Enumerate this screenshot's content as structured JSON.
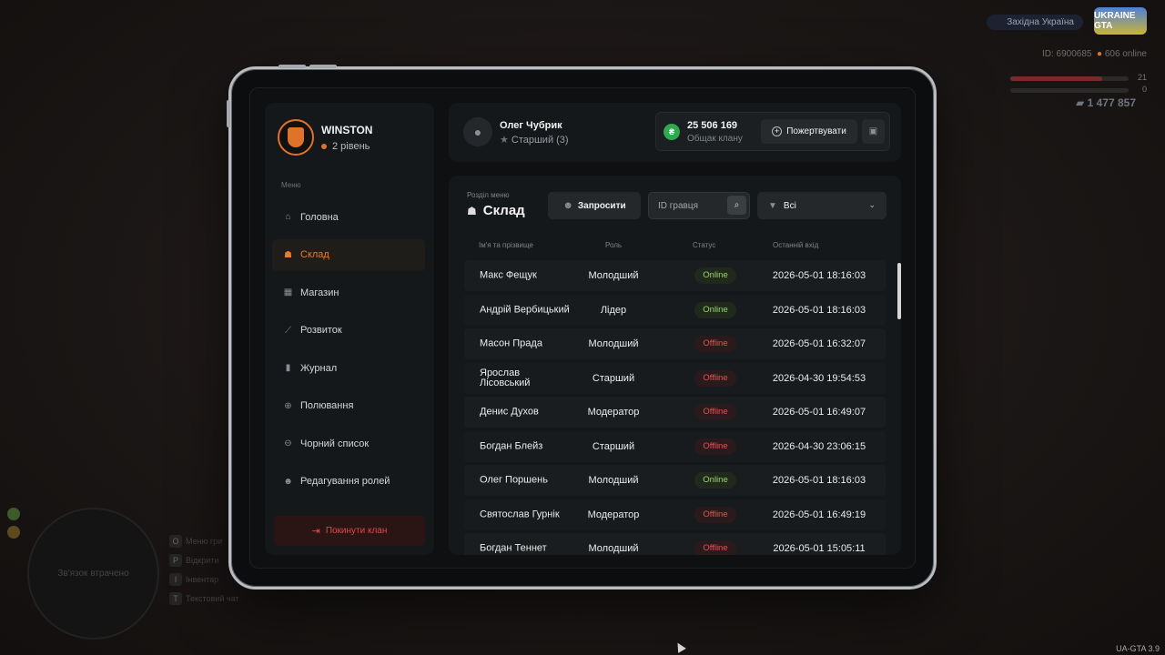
{
  "hud": {
    "region": "Західна Україна",
    "logo": "UKRAINE GTA",
    "id_line": "ID: 6900685",
    "online": "606 online",
    "bar1_value": "21",
    "bar2_value": "0",
    "money": "1 477 857",
    "version": "UA-GTA 3.9",
    "minimap_text": "Зв'язок втрачено",
    "keys": [
      {
        "key": "O",
        "label": "Меню гри"
      },
      {
        "key": "P",
        "label": "Відкрити"
      },
      {
        "key": "I",
        "label": "Інвентар"
      },
      {
        "key": "T",
        "label": "Текстовий чат"
      }
    ]
  },
  "clan": {
    "name": "WINSTON",
    "level": "2 рівень"
  },
  "menu": {
    "caption": "Меню",
    "items": [
      {
        "label": "Головна",
        "icon": "home-icon",
        "glyph": "⌂"
      },
      {
        "label": "Склад",
        "icon": "people-icon",
        "glyph": "☗"
      },
      {
        "label": "Магазин",
        "icon": "shop-icon",
        "glyph": "▦"
      },
      {
        "label": "Розвиток",
        "icon": "chart-icon",
        "glyph": "⟋"
      },
      {
        "label": "Журнал",
        "icon": "book-icon",
        "glyph": "▮"
      },
      {
        "label": "Полювання",
        "icon": "target-icon",
        "glyph": "⊕"
      },
      {
        "label": "Чорний список",
        "icon": "block-icon",
        "glyph": "⊖"
      },
      {
        "label": "Редагування ролей",
        "icon": "user-edit-icon",
        "glyph": "☻"
      }
    ],
    "active_index": 1,
    "leave_label": "Покинути клан"
  },
  "profile": {
    "name": "Олег Чубрик",
    "rank": "Старший (3)"
  },
  "balance": {
    "value": "25 506 169",
    "label": "Общак клану",
    "donate_label": "Пожертвувати"
  },
  "section": {
    "caption": "Розділ меню",
    "title": "Склад",
    "invite_label": "Запросити",
    "search_placeholder": "ID гравця",
    "filter_value": "Всі"
  },
  "table": {
    "headers": {
      "name": "Ім'я та прізвище",
      "role": "Роль",
      "status": "Статус",
      "last": "Останній вхід"
    },
    "rows": [
      {
        "name": "Макс Фещук",
        "role": "Молодший",
        "status": "Online",
        "last": "2026-05-01 18:16:03"
      },
      {
        "name": "Андрій Вербицький",
        "role": "Лідер",
        "status": "Online",
        "last": "2026-05-01 18:16:03"
      },
      {
        "name": "Масон Прада",
        "role": "Молодший",
        "status": "Offline",
        "last": "2026-05-01 16:32:07"
      },
      {
        "name": "Ярослав Лісовський",
        "role": "Старший",
        "status": "Offline",
        "last": "2026-04-30 19:54:53"
      },
      {
        "name": "Денис Духов",
        "role": "Модератор",
        "status": "Offline",
        "last": "2026-05-01 16:49:07"
      },
      {
        "name": "Богдан Блейз",
        "role": "Старший",
        "status": "Offline",
        "last": "2026-04-30 23:06:15"
      },
      {
        "name": "Олег Поршень",
        "role": "Молодший",
        "status": "Online",
        "last": "2026-05-01 18:16:03"
      },
      {
        "name": "Святослав Гурнік",
        "role": "Модератор",
        "status": "Offline",
        "last": "2026-05-01 16:49:19"
      },
      {
        "name": "Богдан Теннет",
        "role": "Молодший",
        "status": "Offline",
        "last": "2026-05-01 15:05:11"
      }
    ]
  },
  "colors": {
    "accent": "#ea7a2c",
    "online": "#9bd46b",
    "offline": "#e05555",
    "coin": "#2fa84f"
  }
}
